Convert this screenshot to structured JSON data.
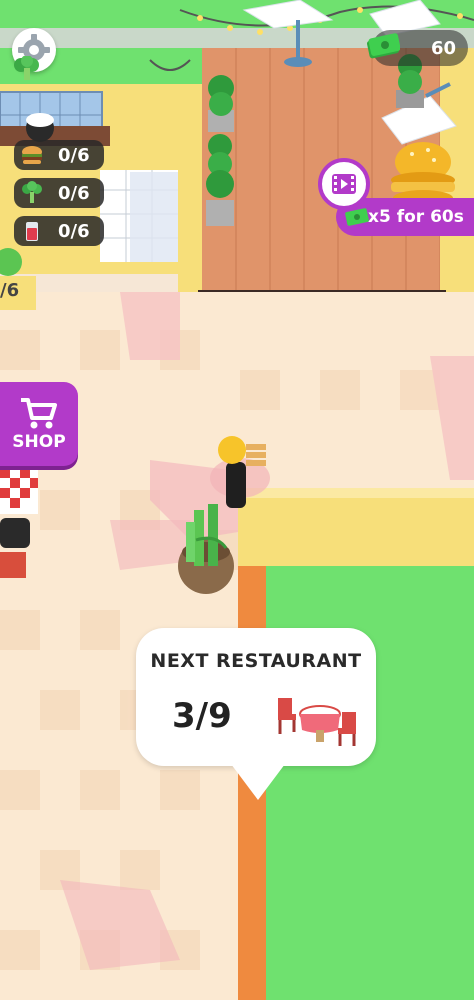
{
  "hud": {
    "money": "60",
    "counters": [
      {
        "icon": "burger-icon",
        "value": "0/6"
      },
      {
        "icon": "broccoli-icon",
        "value": "0/6"
      },
      {
        "icon": "drink-icon",
        "value": "0/6"
      }
    ],
    "partial_counter": "/6"
  },
  "offer": {
    "label": "x5 for 60s"
  },
  "shop": {
    "label": "SHOP"
  },
  "next_restaurant": {
    "title": "NEXT RESTAURANT",
    "progress": "3/9"
  },
  "colors": {
    "accent_purple": "#b23ac9",
    "grass_green": "#6fe16f",
    "deck_wood": "#e0946a",
    "wall_yellow": "#f7df7a",
    "floor_pink": "#f9d3cf"
  }
}
